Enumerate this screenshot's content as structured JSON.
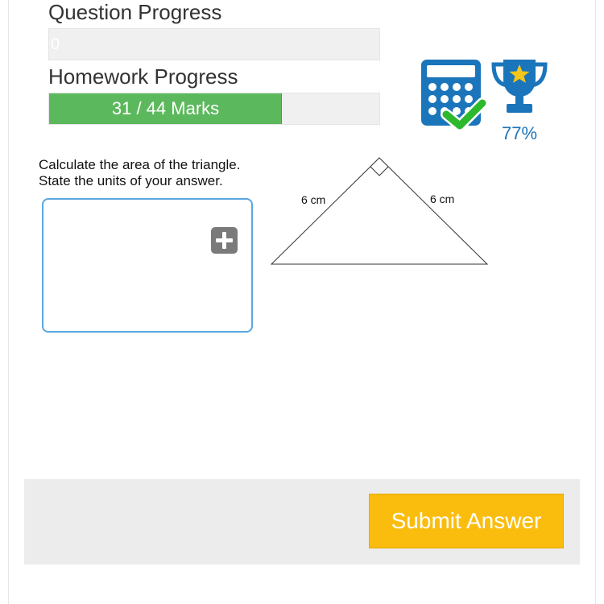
{
  "question_progress": {
    "label": "Question Progress",
    "value_text": "0"
  },
  "homework_progress": {
    "label": "Homework Progress",
    "marks_text": "31 / 44 Marks",
    "fraction": 0.705
  },
  "score": {
    "percent_text": "77%"
  },
  "icons": {
    "calculator": "calculator-check-icon",
    "trophy": "trophy-star-icon",
    "add": "plus-icon"
  },
  "question": {
    "line1": "Calculate the area of the triangle.",
    "line2": "State the units of your answer."
  },
  "diagram": {
    "left_side_label": "6 cm",
    "right_side_label": "6 cm",
    "right_angle": true
  },
  "footer": {
    "submit_label": "Submit Answer"
  },
  "colors": {
    "progress_green": "#5cb85c",
    "icon_blue": "#1b75bb",
    "check_green": "#2db82d",
    "star_yellow": "#f5c518",
    "submit_yellow": "#fbbd0d",
    "input_border_blue": "#5aa7e0"
  }
}
